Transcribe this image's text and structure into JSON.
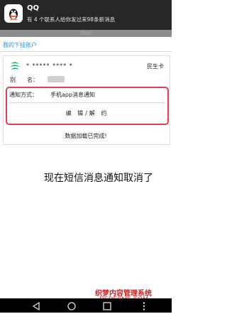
{
  "notification": {
    "app_name": "QQ",
    "message": "有 4 个联系人给你发过来98条新消息"
  },
  "section": {
    "title": "我的下挂账户"
  },
  "account_card": {
    "account_number": "*  *****   ****    *",
    "bank_name": "民生卡",
    "alias_label": "别　　名：",
    "notify_label": "通知方式：",
    "notify_value": "手机app消息通知",
    "edit_label": "编 辑/解 约"
  },
  "status": {
    "loaded_text": "数据加载已完成!"
  },
  "caption": "现在短信消息通知取消了",
  "watermark": {
    "title": "织梦内容管理系统",
    "url": "DEDECMS.COM"
  },
  "colors": {
    "accent_blue": "#2f8fd4",
    "highlight_red": "#e43c53",
    "bank_green": "#1aa260"
  },
  "icons": {
    "app": "qq-penguin-icon",
    "bank": "minsheng-bank-logo",
    "nav": [
      "back-icon",
      "home-icon",
      "recents-icon",
      "menu-icon"
    ]
  }
}
